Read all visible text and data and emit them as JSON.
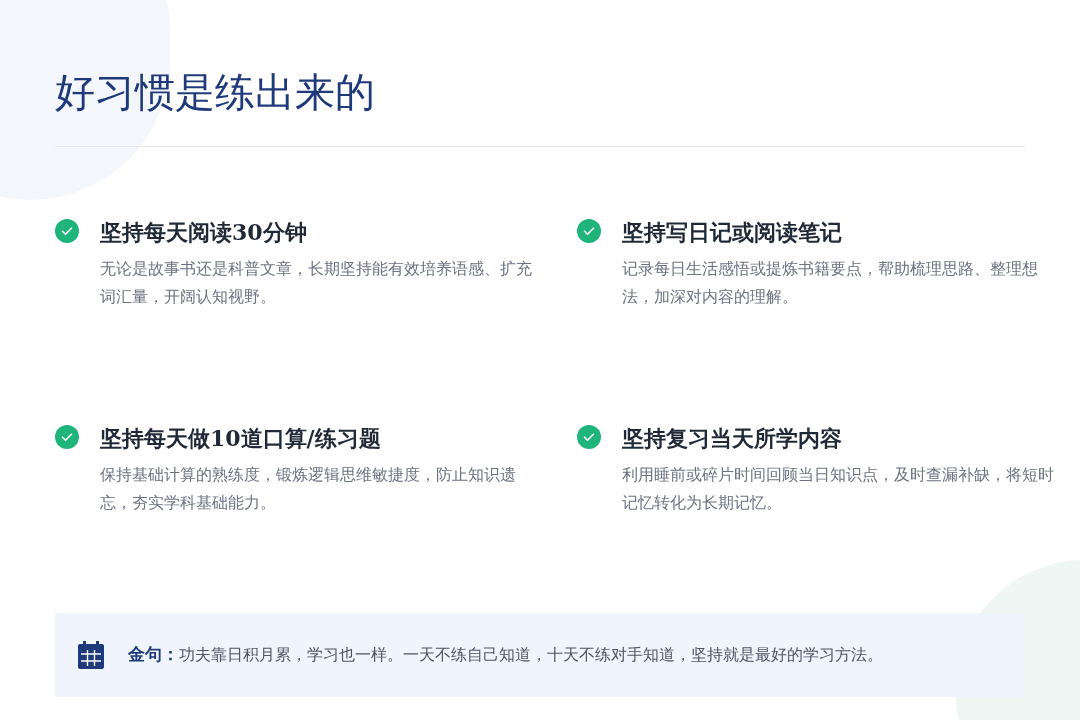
{
  "title": "好习惯是练出来的",
  "habits": [
    {
      "title": "坚持每天阅读30分钟",
      "description": "无论是故事书还是科普文章，长期坚持能有效培养语感、扩充词汇量，开阔认知视野。",
      "checked": true
    },
    {
      "title": "坚持写日记或阅读笔记",
      "description": "记录每日生活感悟或提炼书籍要点，帮助梳理思路、整理想法，加深对内容的理解。",
      "checked": true
    },
    {
      "title": "坚持每天做10道口算/练习题",
      "description": "保持基础计算的熟练度，锻炼逻辑思维敏捷度，防止知识遗忘，夯实学科基础能力。",
      "checked": true
    },
    {
      "title": "坚持复习当天所学内容",
      "description": "利用睡前或碎片时间回顾当日知识点，及时查漏补缺，将短时记忆转化为长期记忆。",
      "checked": true
    }
  ],
  "quote": "**金句：**功夫靠日积月累，学习也一样。一天不练自己知道，十天不练对手知道，坚持就是最好的学习方法。"
}
